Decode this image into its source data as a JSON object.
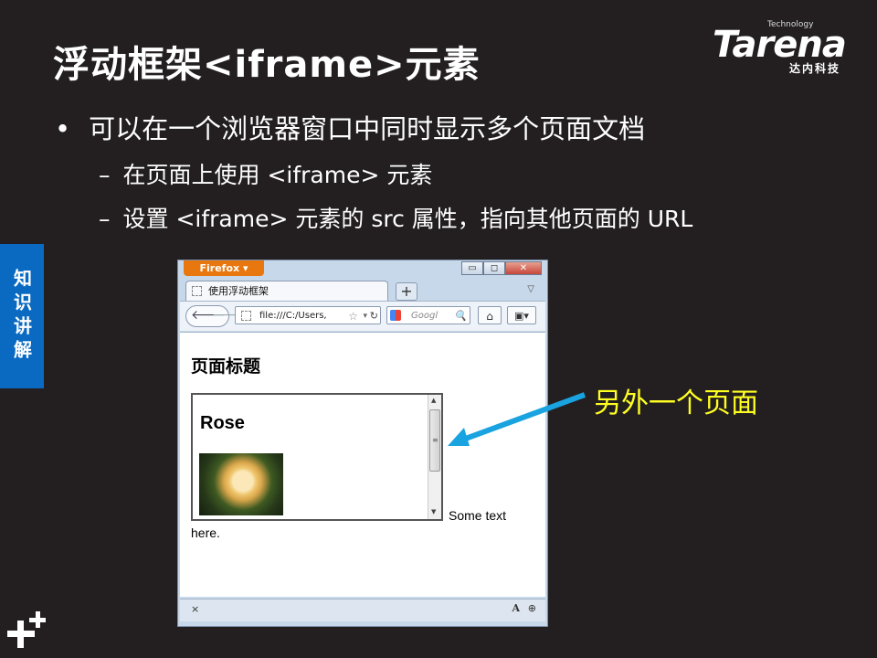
{
  "slide": {
    "title": "浮动框架<iframe>元素",
    "bullet_main": "可以在一个浏览器窗口中同时显示多个页面文档",
    "bullet_sub_1": "在页面上使用 <iframe> 元素",
    "bullet_sub_2": "设置 <iframe> 元素的 src 属性，指向其他页面的 URL",
    "side_tab": "知识讲解",
    "callout": "另外一个页面"
  },
  "logo": {
    "technology": "Technology",
    "name": "Tarena",
    "subtitle": "达内科技"
  },
  "browser": {
    "firefox_button": "Firefox",
    "minimize": "▭",
    "maximize": "◻",
    "close": "✕",
    "tab_title": "使用浮动框架",
    "new_tab": "+",
    "url": "file:///C:/Users,",
    "search_placeholder": "Googl",
    "page_heading": "页面标题",
    "iframe_heading": "Rose",
    "text_after_iframe": "Some text",
    "text_wrapped": "here."
  },
  "colors": {
    "slide_background": "#231f20",
    "callout_text": "#ffff22",
    "callout_arrow": "#19a3e0",
    "side_tab": "#0a6ac2",
    "firefox_orange": "#e8770f"
  },
  "icons": [
    "back-arrow-icon",
    "forward-arrow-icon",
    "page-icon",
    "star-icon",
    "reload-icon",
    "google-icon",
    "search-icon",
    "home-icon",
    "bookmark-icon",
    "close-icon",
    "font-icon",
    "zoom-icon",
    "plus-mark-icon"
  ]
}
